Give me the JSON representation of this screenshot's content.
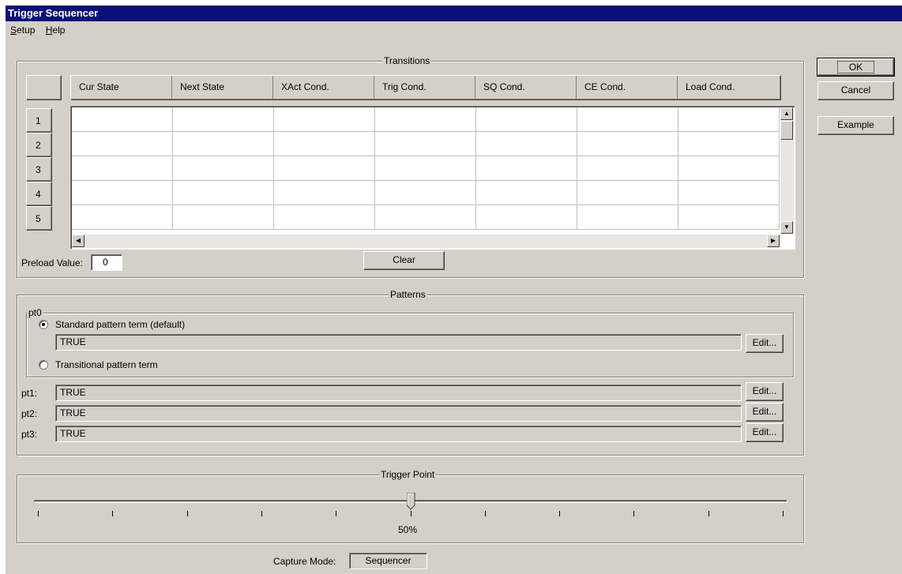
{
  "window": {
    "title": "Trigger Sequencer"
  },
  "menu": [
    {
      "accel": "S",
      "rest": "etup"
    },
    {
      "accel": "H",
      "rest": "elp"
    }
  ],
  "transitions": {
    "label": "Transitions",
    "columns": [
      "Cur State",
      "Next State",
      "XAct Cond.",
      "Trig Cond.",
      "SQ Cond.",
      "CE Cond.",
      "Load Cond."
    ],
    "rows": [
      "1",
      "2",
      "3",
      "4",
      "5"
    ],
    "preload_label": "Preload Value:",
    "preload_value": "0",
    "clear_label": "Clear"
  },
  "patterns": {
    "label": "Patterns",
    "pt0_label": "pt0",
    "standard_label": "Standard pattern term (default)",
    "standard_selected": true,
    "pt0_value": "TRUE",
    "transitional_label": "Transitional pattern term",
    "edit_label": "Edit...",
    "terms": [
      {
        "label": "pt1:",
        "value": "TRUE"
      },
      {
        "label": "pt2:",
        "value": "TRUE"
      },
      {
        "label": "pt3:",
        "value": "TRUE"
      }
    ]
  },
  "trigger_point": {
    "label": "Trigger Point",
    "value_label": "50%",
    "fraction": 0.5
  },
  "capture": {
    "label": "Capture Mode:",
    "value": "Sequencer"
  },
  "buttons": {
    "ok": "OK",
    "cancel": "Cancel",
    "example": "Example"
  },
  "colors": {
    "titlebar": "#0a1075",
    "face": "#d4d0c8"
  }
}
